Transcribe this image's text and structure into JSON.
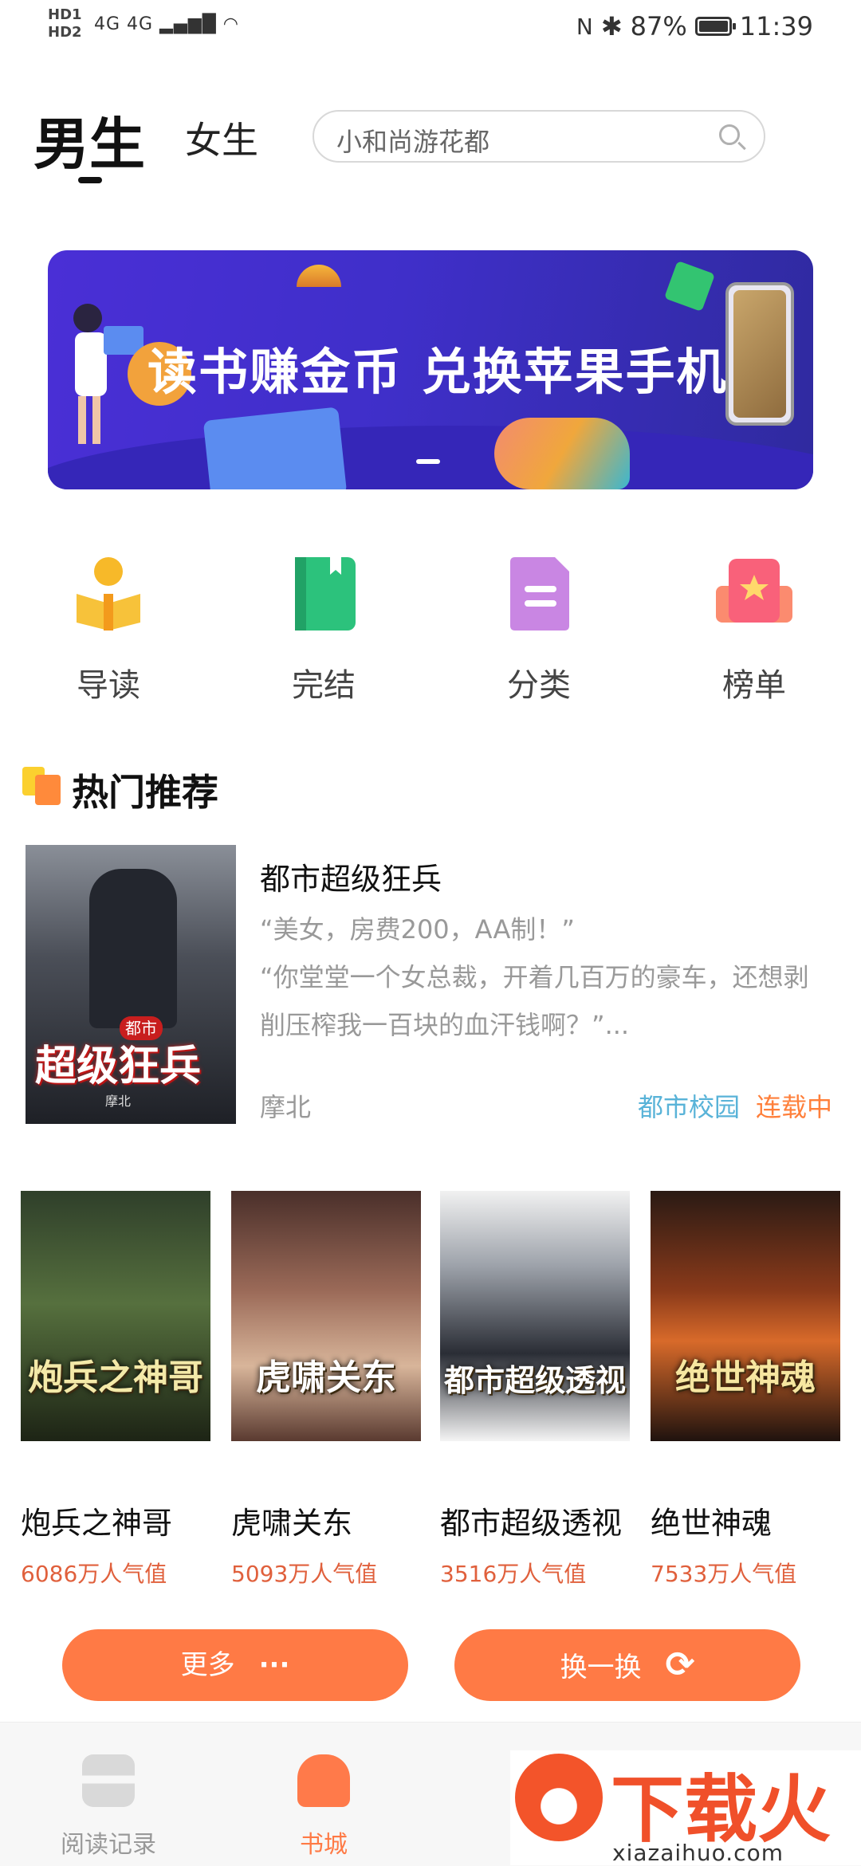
{
  "status_bar": {
    "hd_labels": [
      "HD1",
      "HD2"
    ],
    "network": "4G 4G",
    "battery_percent": "87%",
    "battery_level": 0.87,
    "time": "11:39"
  },
  "header": {
    "tabs": [
      {
        "label": "男生",
        "active": true
      },
      {
        "label": "女生",
        "active": false
      }
    ],
    "search_placeholder": "小和尚游花都"
  },
  "banner": {
    "text": "读书赚金币  兑换苹果手机"
  },
  "categories": [
    {
      "label": "导读",
      "icon": "guide-reading-icon",
      "color": "#f7b929"
    },
    {
      "label": "完结",
      "icon": "finished-book-icon",
      "color": "#2cc27c"
    },
    {
      "label": "分类",
      "icon": "category-document-icon",
      "color": "#c986e3"
    },
    {
      "label": "榜单",
      "icon": "ranking-star-icon",
      "color": "#f9617a"
    }
  ],
  "section": {
    "title": "热门推荐"
  },
  "featured": {
    "cover_text": "超级狂兵",
    "cover_tag": "都市",
    "cover_author": "摩北",
    "title": "都市超级狂兵",
    "description": "“美女，房费200，AA制！”\n“你堂堂一个女总裁，开着几百万的豪车，还想剥削压榨我一百块的血汗钱啊？”...",
    "author": "摩北",
    "genre": "都市校园",
    "status": "连载中"
  },
  "books": [
    {
      "title": "炮兵之神哥",
      "popularity": "6086万人气值",
      "cover_text": "炮兵之神哥"
    },
    {
      "title": "虎啸关东",
      "popularity": "5093万人气值",
      "cover_text": "虎啸关东"
    },
    {
      "title": "都市超级透视",
      "popularity": "3516万人气值",
      "cover_text": "都市超级透视"
    },
    {
      "title": "绝世神魂",
      "popularity": "7533万人气值",
      "cover_text": "绝世神魂"
    }
  ],
  "buttons": {
    "more": "更多",
    "more_symbol": "···",
    "refresh": "换一换",
    "refresh_symbol": "⟳"
  },
  "bottom_nav": [
    {
      "label": "阅读记录",
      "icon": "reading-history-icon",
      "active": false
    },
    {
      "label": "书城",
      "icon": "bookstore-icon",
      "active": true
    }
  ],
  "watermark": {
    "brand": "下载火",
    "domain": "xiazaihuo.com"
  },
  "colors": {
    "accent": "#ff7a45",
    "genre": "#59b3d8",
    "status": "#ff7f3a",
    "popularity": "#e0603c"
  }
}
